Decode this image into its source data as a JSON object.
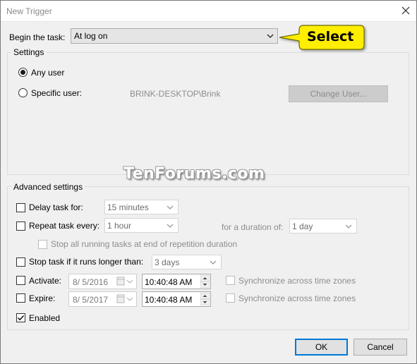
{
  "window": {
    "title": "New Trigger"
  },
  "begin": {
    "label": "Begin the task:",
    "value": "At log on"
  },
  "callout": {
    "text": "Select",
    "color": "#ffee00"
  },
  "settings": {
    "title": "Settings",
    "any_user_label": "Any user",
    "specific_user_label": "Specific user:",
    "specific_user_value": "BRINK-DESKTOP\\Brink",
    "change_user_label": "Change User...",
    "selected": "any_user"
  },
  "watermark": {
    "text": "TenForums.com"
  },
  "advanced": {
    "title": "Advanced settings",
    "delay": {
      "label": "Delay task for:",
      "value": "15 minutes",
      "checked": false
    },
    "repeat": {
      "label": "Repeat task every:",
      "value": "1 hour",
      "checked": false,
      "duration_label": "for a duration of:",
      "duration_value": "1 day"
    },
    "stop_running": {
      "label": "Stop all running tasks at end of repetition duration",
      "checked": false,
      "enabled": false
    },
    "stop_longer": {
      "label": "Stop task if it runs longer than:",
      "value": "3 days",
      "checked": false
    },
    "activate": {
      "label": "Activate:",
      "date": "8/ 5/2016",
      "time": "10:40:48 AM",
      "checked": false,
      "sync_label": "Synchronize across time zones"
    },
    "expire": {
      "label": "Expire:",
      "date": "8/ 5/2017",
      "time": "10:40:48 AM",
      "checked": false,
      "sync_label": "Synchronize across time zones"
    },
    "enabled": {
      "label": "Enabled",
      "checked": true
    }
  },
  "buttons": {
    "ok_label": "OK",
    "cancel_label": "Cancel"
  }
}
